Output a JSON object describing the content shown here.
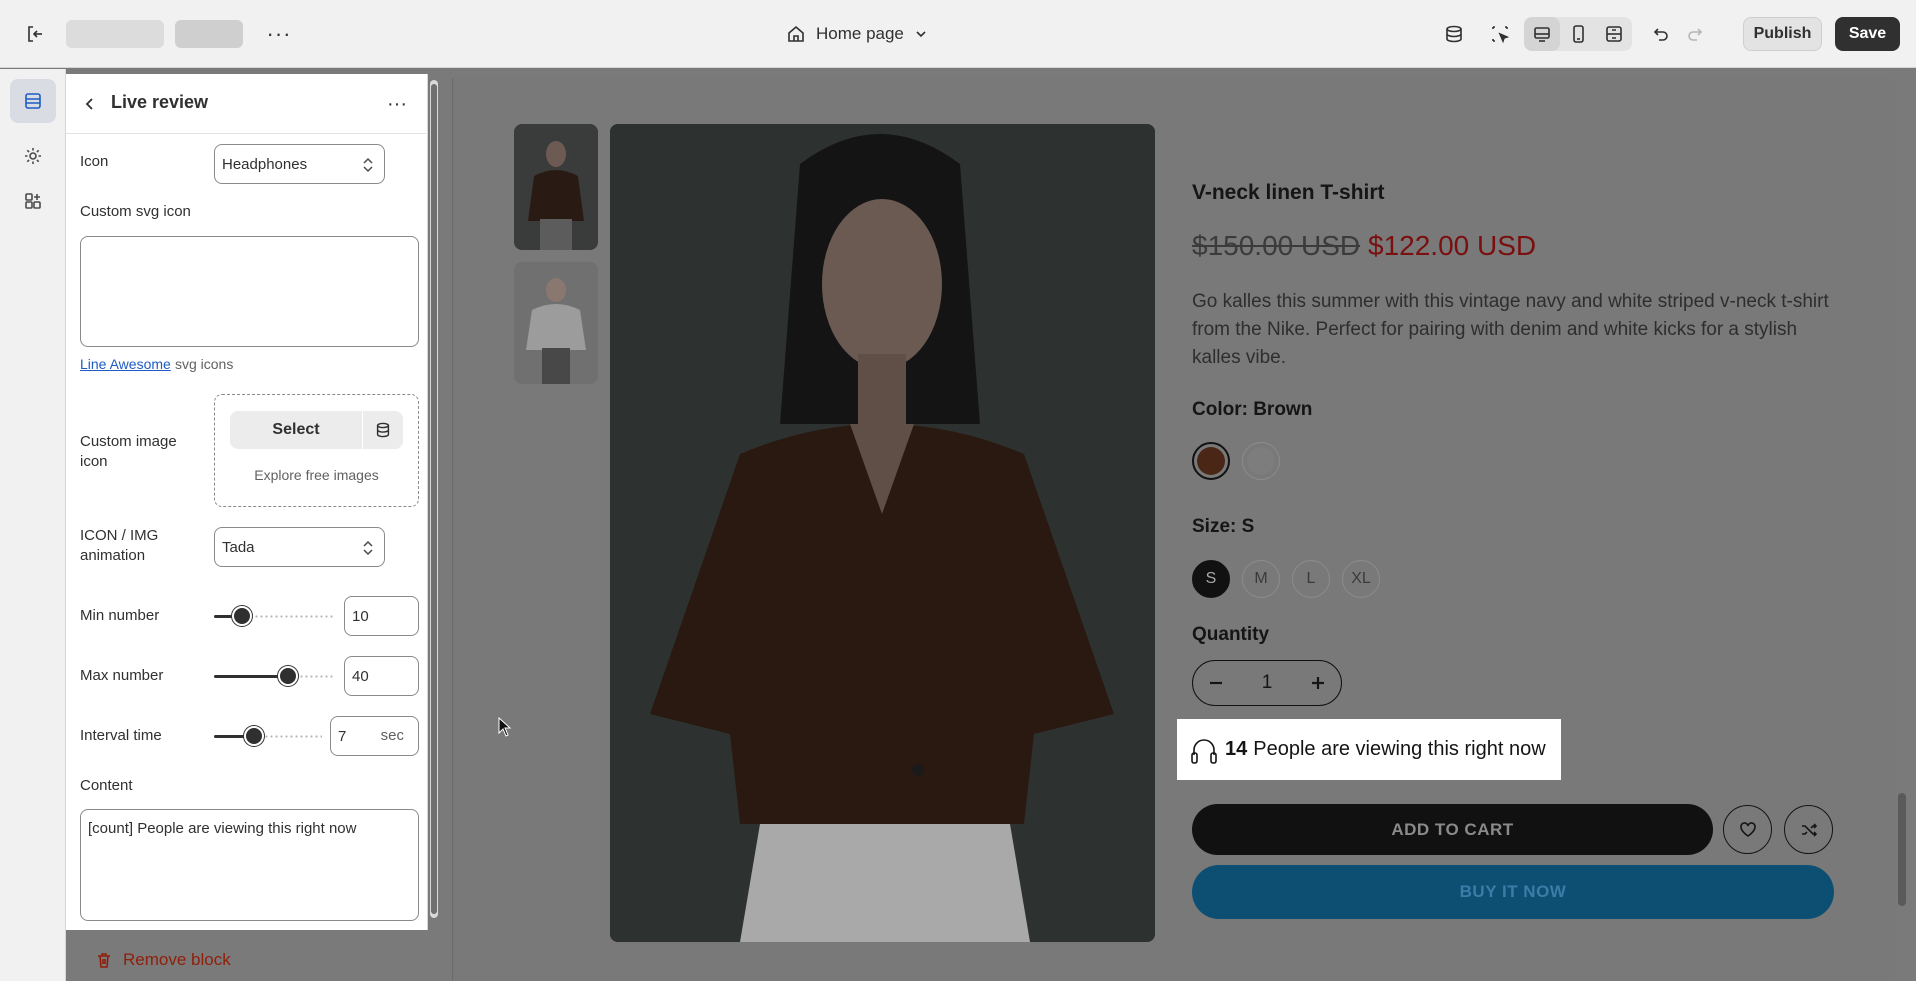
{
  "topbar": {
    "page_selector": "Home page",
    "publish": "Publish",
    "save": "Save"
  },
  "panel": {
    "title": "Live review",
    "icon_label": "Icon",
    "icon_value": "Headphones",
    "custom_svg_label": "Custom svg icon",
    "custom_svg_value": "",
    "line_awesome_link": "Line Awesome",
    "line_awesome_suffix": "svg icons",
    "custom_image_label": "Custom image icon",
    "select_button": "Select",
    "explore_free": "Explore free images",
    "animation_label": "ICON / IMG animation",
    "animation_value": "Tada",
    "min_label": "Min number",
    "min_value": "10",
    "max_label": "Max number",
    "max_value": "40",
    "interval_label": "Interval time",
    "interval_value": "7",
    "interval_unit": "sec",
    "content_label": "Content",
    "content_value": "[count] People are viewing this right now",
    "remove_block": "Remove block",
    "sliders": {
      "min_fraction": 0.18,
      "max_fraction": 0.64,
      "interval_fraction": 0.34
    }
  },
  "product": {
    "title": "V-neck linen T-shirt",
    "compare_price": "$150.00 USD",
    "price": "$122.00 USD",
    "description": "Go kalles this summer with this vintage navy and white striped v-neck t-shirt from the Nike. Perfect for pairing with denim and white kicks for a stylish kalles vibe.",
    "color_label": "Color: Brown",
    "size_label": "Size: S",
    "sizes": [
      "S",
      "M",
      "L",
      "XL"
    ],
    "quantity_label": "Quantity",
    "quantity": "1",
    "live_count": "14",
    "live_text": "People are viewing this right now",
    "add_to_cart": "ADD TO CART",
    "buy_now": "BUY IT NOW"
  },
  "colors": {
    "accent_link": "#1f5cc4",
    "price_sale": "#7a0f0f",
    "buy_button": "#0c4f73",
    "swatch_brown": "#4a2617"
  }
}
